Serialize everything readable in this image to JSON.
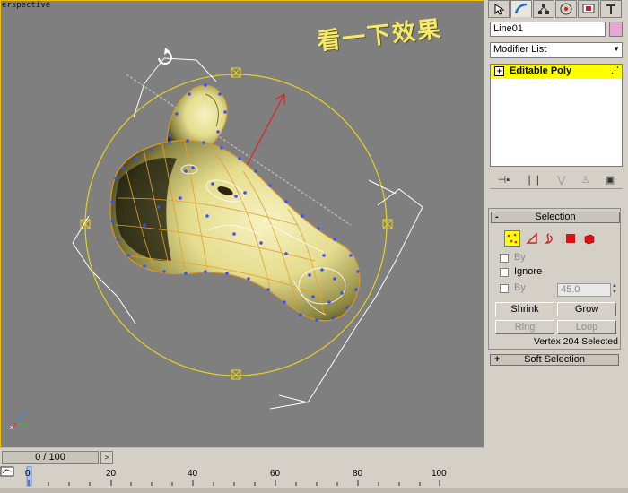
{
  "viewport": {
    "label": "erspective",
    "annotation": "看一下效果"
  },
  "command_panel": {
    "tabs": [
      "create-icon",
      "modify-icon",
      "hierarchy-icon",
      "motion-icon",
      "display-icon",
      "utilities-icon"
    ],
    "object_name": "Line01",
    "object_color": "#e8a6d7",
    "modifier_list": "Modifier List",
    "stack_item": "Editable Poly",
    "stack_item_sign": "+",
    "stack_tools": [
      "pin-stack-icon",
      "show-end-result-icon",
      "make-unique-icon",
      "remove-modifier-icon",
      "configure-modifier-sets-icon"
    ]
  },
  "selection_rollout": {
    "sign": "-",
    "title": "Selection",
    "by_vertex_label": "By",
    "ignore_backfacing_label": "Ignore",
    "by_angle_label": "By",
    "by_angle_value": "45.0",
    "shrink_label": "Shrink",
    "grow_label": "Grow",
    "ring_label": "Ring",
    "loop_label": "Loop",
    "status": "Vertex 204 Selected"
  },
  "soft_selection_rollout": {
    "sign": "+",
    "title": "Soft Selection"
  },
  "timeline": {
    "slider_text": "0 / 100",
    "next_symbol": ">",
    "ticks": [
      "0",
      "20",
      "40",
      "60",
      "80",
      "100"
    ]
  },
  "colors": {
    "viewport_bg": "#7f7f7f",
    "active_border": "#f0c000",
    "selection_highlight": "#ffff00",
    "vertex_color": "#3a4dff",
    "gizmo_circle": "#e8d020",
    "model_fill": "#e6e09a"
  }
}
